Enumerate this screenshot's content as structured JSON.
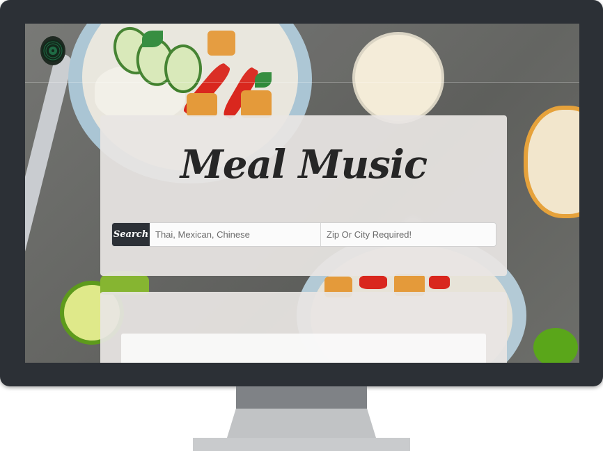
{
  "app": {
    "title": "Meal Music",
    "logo_icon": "vinyl-record-icon"
  },
  "search": {
    "button_label": "Search",
    "cuisine_placeholder": "Thai, Mexican, Chinese",
    "cuisine_value": "",
    "location_placeholder": "Zip Or City Required!",
    "location_value": ""
  },
  "colors": {
    "bezel": "#2c3036",
    "panel": "#e8e5e3",
    "button": "#2c3036",
    "title_text": "#262626"
  }
}
